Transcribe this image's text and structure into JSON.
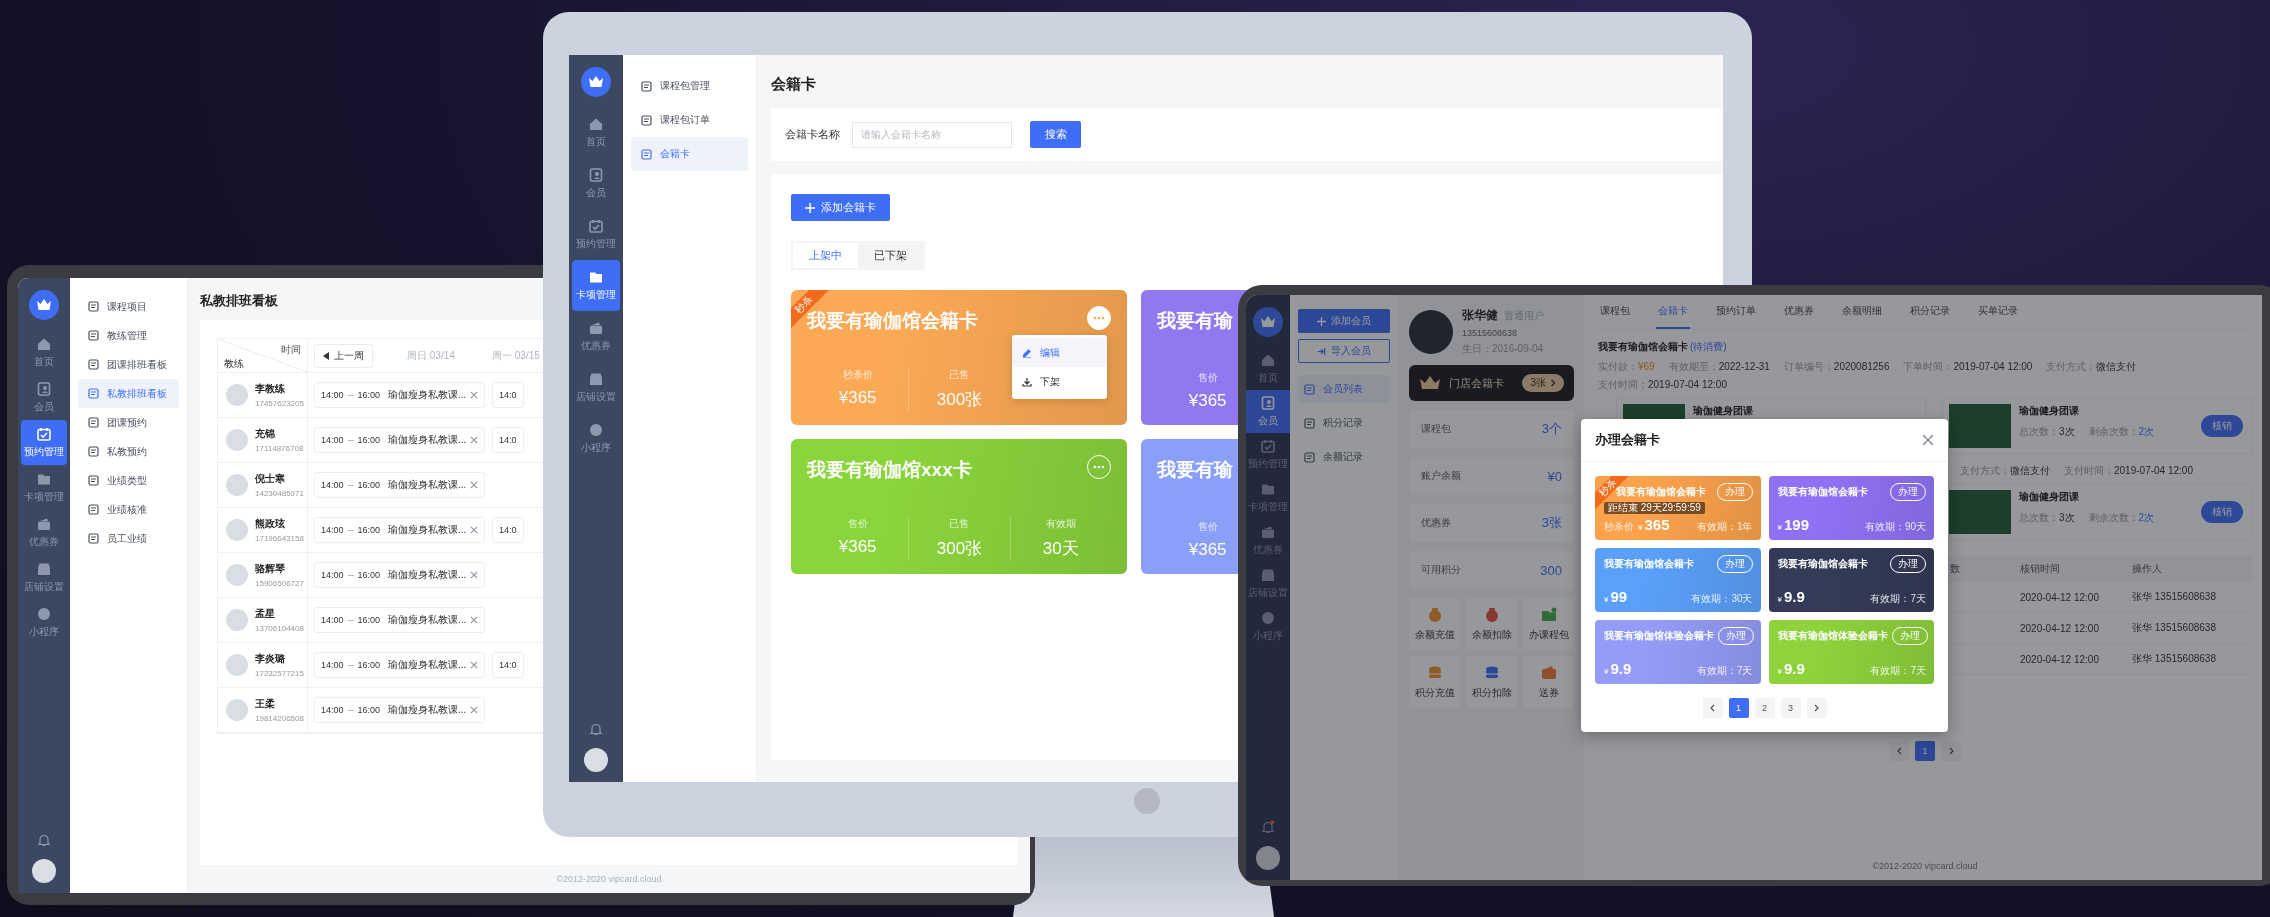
{
  "laptop": {
    "nav": [
      {
        "label": "首页",
        "selected": false
      },
      {
        "label": "会员",
        "selected": false
      },
      {
        "label": "预约管理",
        "selected": true
      },
      {
        "label": "卡项管理",
        "selected": false
      },
      {
        "label": "优惠券",
        "selected": false
      },
      {
        "label": "店铺设置",
        "selected": false
      },
      {
        "label": "小程序",
        "selected": false
      }
    ],
    "submenu": [
      {
        "label": "课程项目",
        "selected": false
      },
      {
        "label": "教练管理",
        "selected": false
      },
      {
        "label": "团课排班看板",
        "selected": false
      },
      {
        "label": "私教排班看板",
        "selected": true
      },
      {
        "label": "团课预约",
        "selected": false
      },
      {
        "label": "私教预约",
        "selected": false
      },
      {
        "label": "业绩类型",
        "selected": false
      },
      {
        "label": "业绩核准",
        "selected": false
      },
      {
        "label": "员工业绩",
        "selected": false
      }
    ],
    "title": "私教排班看板",
    "schedule": {
      "corner_top": "时间",
      "corner_bottom": "教练",
      "prev_week": "上一周",
      "days": [
        "周日 03/14",
        "周一 03/15"
      ],
      "rows": [
        {
          "name": "李教练",
          "phone": "17457623205",
          "start": "14:00",
          "end": "16:00",
          "course": "瑜伽瘦身私教课...",
          "next": "14:0"
        },
        {
          "name": "充锦",
          "phone": "17114876708",
          "start": "14:00",
          "end": "16:00",
          "course": "瑜伽瘦身私教课...",
          "next": "14:0"
        },
        {
          "name": "倪士寒",
          "phone": "14230485971",
          "start": "14:00",
          "end": "16:00",
          "course": "瑜伽瘦身私教课..."
        },
        {
          "name": "熊政玹",
          "phone": "17196643158",
          "start": "14:00",
          "end": "16:00",
          "course": "瑜伽瘦身私教课...",
          "next": "14:0"
        },
        {
          "name": "骆辉琴",
          "phone": "15906506727",
          "start": "14:00",
          "end": "16:00",
          "course": "瑜伽瘦身私教课..."
        },
        {
          "name": "孟星",
          "phone": "13706104408",
          "start": "14:00",
          "end": "16:00",
          "course": "瑜伽瘦身私教课..."
        },
        {
          "name": "李炎璐",
          "phone": "17232577215",
          "start": "14:00",
          "end": "16:00",
          "course": "瑜伽瘦身私教课...",
          "next": "14:0"
        },
        {
          "name": "王柔",
          "phone": "19814206508",
          "start": "14:00",
          "end": "16:00",
          "course": "瑜伽瘦身私教课..."
        }
      ]
    },
    "footer": "©2012-2020 vipcard.cloud"
  },
  "monitor": {
    "nav": [
      {
        "label": "首页",
        "selected": false
      },
      {
        "label": "会员",
        "selected": false
      },
      {
        "label": "预约管理",
        "selected": false
      },
      {
        "label": "卡项管理",
        "selected": true
      },
      {
        "label": "优惠券",
        "selected": false
      },
      {
        "label": "店铺设置",
        "selected": false
      },
      {
        "label": "小程序",
        "selected": false
      }
    ],
    "submenu": [
      {
        "label": "课程包管理",
        "selected": false
      },
      {
        "label": "课程包订单",
        "selected": false
      },
      {
        "label": "会籍卡",
        "selected": true
      }
    ],
    "title": "会籍卡",
    "search": {
      "label": "会籍卡名称",
      "placeholder": "请输入会籍卡名称",
      "button": "搜索"
    },
    "add_button": "添加会籍卡",
    "tabs": [
      {
        "label": "上架中",
        "selected": true
      },
      {
        "label": "已下架",
        "selected": false
      }
    ],
    "cards": [
      {
        "title": "我要有瑜伽馆会籍卡",
        "color": "#fba955",
        "ribbon": "秒杀",
        "stats": [
          {
            "label": "秒杀价",
            "value": "¥365"
          },
          {
            "label": "已售",
            "value": "300张"
          }
        ],
        "menu": [
          {
            "label": "编辑",
            "selected": true
          },
          {
            "label": "下架",
            "selected": false
          }
        ]
      },
      {
        "title": "我要有瑜",
        "color": "#9178f0",
        "stats": [
          {
            "label": "售价",
            "value": "¥365"
          }
        ]
      },
      {
        "title": "我要有瑜伽馆xxx卡",
        "color": "#8ad43c",
        "stats": [
          {
            "label": "售价",
            "value": "¥365"
          },
          {
            "label": "已售",
            "value": "300张"
          },
          {
            "label": "有效期",
            "value": "30天"
          }
        ]
      },
      {
        "title": "我要有瑜",
        "color": "#8aa0f8",
        "stats": [
          {
            "label": "售价",
            "value": "¥365"
          }
        ]
      }
    ]
  },
  "tablet": {
    "nav": [
      {
        "label": "首页",
        "selected": false
      },
      {
        "label": "会员",
        "selected": true
      },
      {
        "label": "预约管理",
        "selected": false
      },
      {
        "label": "卡项管理",
        "selected": false
      },
      {
        "label": "优惠券",
        "selected": false
      },
      {
        "label": "店铺设置",
        "selected": false
      },
      {
        "label": "小程序",
        "selected": false
      }
    ],
    "unread": true,
    "add_member": "添加会员",
    "import_member": "导入会员",
    "submenu": [
      {
        "label": "会员列表",
        "selected": true
      },
      {
        "label": "积分记录",
        "selected": false
      },
      {
        "label": "余额记录",
        "selected": false
      }
    ],
    "profile": {
      "name": "张华健",
      "tag": "普通用户",
      "phone": "13515608638",
      "birthday": "生日：2016-09-04"
    },
    "store_card": {
      "label": "门店会籍卡",
      "count": "3张"
    },
    "stats": [
      {
        "label": "课程包",
        "value": "3个"
      },
      {
        "label": "账户余额",
        "value": "¥0"
      },
      {
        "label": "优惠券",
        "value": "3张"
      },
      {
        "label": "可用积分",
        "value": "300"
      }
    ],
    "actions": [
      "余额充值",
      "余额扣除",
      "办课程包",
      "积分充值",
      "积分扣除",
      "送券"
    ],
    "tabs": [
      {
        "label": "课程包",
        "selected": false
      },
      {
        "label": "会籍卡",
        "selected": true
      },
      {
        "label": "预约订单",
        "selected": false
      },
      {
        "label": "优惠券",
        "selected": false
      },
      {
        "label": "余额明细",
        "selected": false
      },
      {
        "label": "积分记录",
        "selected": false
      },
      {
        "label": "买单记录",
        "selected": false
      }
    ],
    "orders": [
      {
        "title": "我要有瑜伽馆会籍卡",
        "status": "(待消费)",
        "info": [
          {
            "label": "实付款：",
            "value": "¥69"
          },
          {
            "label": "有效期至：",
            "value": "2022-12-31"
          },
          {
            "label": "订单编号：",
            "value": "2020081256"
          },
          {
            "label": "下单时间：",
            "value": "2019-07-04 12:00"
          },
          {
            "label": "支付方式：",
            "value": "微信支付"
          },
          {
            "label": "支付时间：",
            "value": "2019-07-04 12:00"
          }
        ],
        "courses": [
          {
            "title": "瑜伽健身团课"
          },
          {
            "title": "瑜伽健身团课",
            "total_label": "总次数：",
            "total": "3次",
            "remaining_label": "剩余次数：",
            "remaining": "2次",
            "button": "核销"
          }
        ]
      },
      {
        "info": [
          {
            "label": "支付方式：",
            "value": "微信支付"
          },
          {
            "label": "支付时间：",
            "value": "2019-07-04 12:00"
          }
        ],
        "courses": [
          {
            "title": "瑜伽健身团课",
            "total_label": "总次数：",
            "total": "3次",
            "remaining_label": "剩余次数：",
            "remaining": "2次",
            "button": "核销"
          }
        ]
      }
    ],
    "table": {
      "columns": [
        "数",
        "核销时间",
        "操作人"
      ],
      "rows": [
        [
          "",
          "2020-04-12 12:00",
          "张华 13515608638"
        ],
        [
          "",
          "2020-04-12 12:00",
          "张华 13515608638"
        ],
        [
          "",
          "2020-04-12 12:00",
          "张华 13515608638"
        ]
      ]
    },
    "pages": [
      {
        "label": "1",
        "selected": true
      }
    ],
    "footer": "©2012-2020 vipcard.cloud",
    "modal": {
      "title": "办理会籍卡",
      "cards": [
        {
          "title": "我要有瑜伽馆会籍卡",
          "color": "#fba24c",
          "ribbon": "秒杀",
          "button": "办理",
          "countdown": "距结束 29天29:59:59",
          "price_label": "秒杀价",
          "currency": "¥",
          "price": "365",
          "validity": "有效期：1年"
        },
        {
          "title": "我要有瑜伽馆会籍卡",
          "color": "#8f72f4",
          "button": "办理",
          "currency": "¥",
          "price": "199",
          "validity": "有效期：90天"
        },
        {
          "title": "我要有瑜伽馆会籍卡",
          "color": "#5aa0fa",
          "button": "办理",
          "currency": "¥",
          "price": "99",
          "validity": "有效期：30天"
        },
        {
          "title": "我要有瑜伽馆会籍卡",
          "color": "#343b58",
          "button": "办理",
          "currency": "¥",
          "price": "9.9",
          "validity": "有效期：7天"
        },
        {
          "title": "我要有瑜伽馆体验会籍卡",
          "color": "#949cf7",
          "button": "办理",
          "currency": "¥",
          "price": "9.9",
          "validity": "有效期：7天"
        },
        {
          "title": "我要有瑜伽馆体验会籍卡",
          "color": "#8ed23c",
          "button": "办理",
          "currency": "¥",
          "price": "9.9",
          "validity": "有效期：7天"
        }
      ],
      "pages": [
        {
          "label": "1",
          "selected": true
        },
        {
          "label": "2",
          "selected": false
        },
        {
          "label": "3",
          "selected": false
        }
      ]
    }
  }
}
